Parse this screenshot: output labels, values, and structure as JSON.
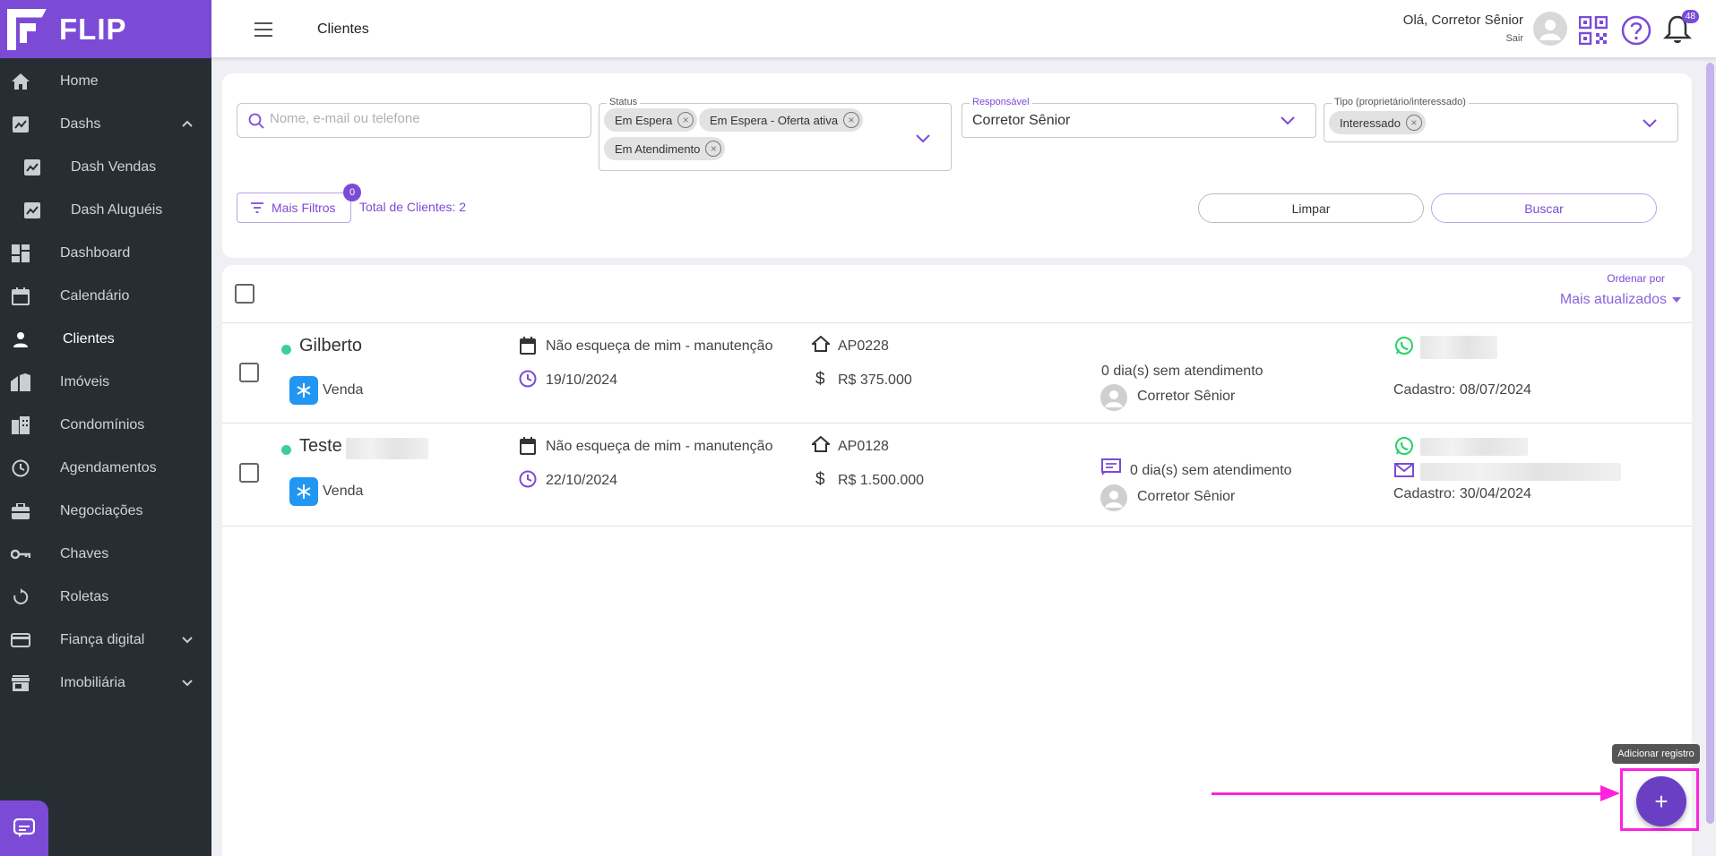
{
  "brand": {
    "name": "FLIP",
    "color": "#7b4bd6"
  },
  "sidebar": {
    "items": [
      {
        "label": "Home",
        "icon": "home-icon"
      },
      {
        "label": "Dashs",
        "icon": "chart-icon"
      },
      {
        "label": "Dash Vendas",
        "icon": "chart-icon"
      },
      {
        "label": "Dash Aluguéis",
        "icon": "chart-icon"
      },
      {
        "label": "Dashboard",
        "icon": "dashboard-icon"
      },
      {
        "label": "Calendário",
        "icon": "calendar-icon"
      },
      {
        "label": "Clientes",
        "icon": "person-icon"
      },
      {
        "label": "Imóveis",
        "icon": "building-icon"
      },
      {
        "label": "Condomínios",
        "icon": "city-icon"
      },
      {
        "label": "Agendamentos",
        "icon": "clock-icon"
      },
      {
        "label": "Negociações",
        "icon": "briefcase-icon"
      },
      {
        "label": "Chaves",
        "icon": "key-icon"
      },
      {
        "label": "Roletas",
        "icon": "rotate-icon"
      },
      {
        "label": "Fiança digital",
        "icon": "card-icon"
      },
      {
        "label": "Imobiliária",
        "icon": "store-icon"
      }
    ]
  },
  "header": {
    "title": "Clientes",
    "greeting": "Olá, Corretor Sênior",
    "logout": "Sair",
    "notifications": "48"
  },
  "filters": {
    "search_placeholder": "Nome, e-mail ou telefone",
    "status_label": "Status",
    "status_chips": [
      "Em Espera",
      "Em Espera - Oferta ativa",
      "Em Atendimento"
    ],
    "responsavel_label": "Responsável",
    "responsavel_value": "Corretor Sênior",
    "tipo_label": "Tipo (proprietário/interessado)",
    "tipo_chips": [
      "Interessado"
    ],
    "more_filters": "Mais Filtros",
    "more_filters_count": "0",
    "total": "Total de Clientes: 2",
    "clear": "Limpar",
    "search": "Buscar"
  },
  "list": {
    "order_label": "Ordenar por",
    "order_value": "Mais atualizados",
    "rows": [
      {
        "name": "Gilberto",
        "type": "Venda",
        "task": "Não esqueça de mim - manutenção",
        "date": "19/10/2024",
        "code": "AP0228",
        "price": "R$ 375.000",
        "days": "0 dia(s) sem atendimento",
        "agent": "Corretor Sênior",
        "registered": "Cadastro: 08/07/2024"
      },
      {
        "name": "Teste",
        "type": "Venda",
        "task": "Não esqueça de mim - manutenção",
        "date": "22/10/2024",
        "code": "AP0128",
        "price": "R$ 1.500.000",
        "days": "0 dia(s) sem atendimento",
        "agent": "Corretor Sênior",
        "registered": "Cadastro: 30/04/2024"
      }
    ]
  },
  "fab": {
    "tooltip": "Adicionar registro",
    "label": "+"
  }
}
